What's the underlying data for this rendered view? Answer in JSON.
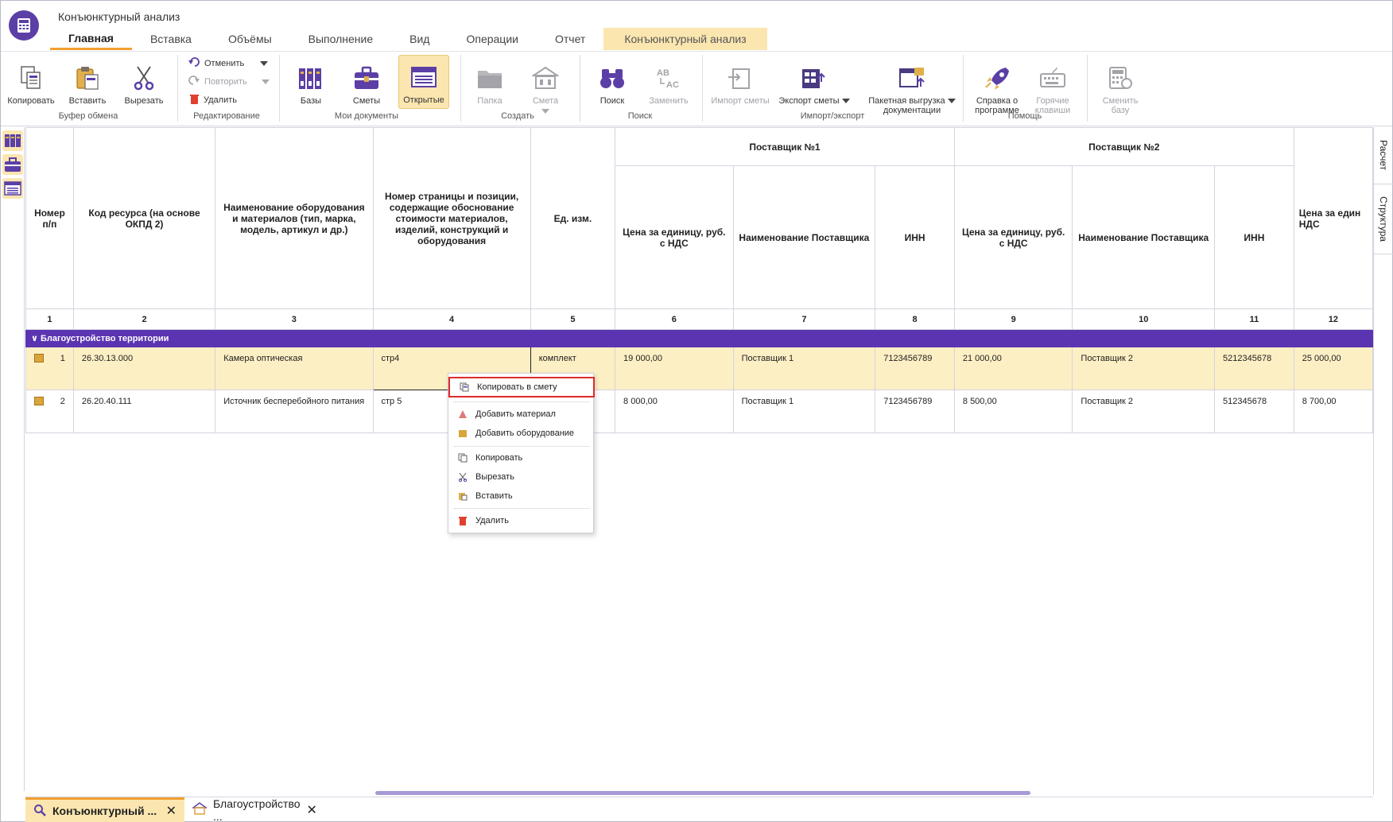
{
  "app": {
    "title": "Конъюнктурный анализ"
  },
  "tabs": [
    {
      "label": "Главная",
      "active": true
    },
    {
      "label": "Вставка"
    },
    {
      "label": "Объёмы"
    },
    {
      "label": "Выполнение"
    },
    {
      "label": "Вид"
    },
    {
      "label": "Операции"
    },
    {
      "label": "Отчет"
    },
    {
      "label": "Конъюнктурный анализ",
      "contextual": true
    }
  ],
  "ribbon": {
    "clipboard": {
      "copy": "Копировать",
      "paste": "Вставить",
      "cut": "Вырезать",
      "group": "Буфер обмена"
    },
    "edit": {
      "undo": "Отменить",
      "redo": "Повторить",
      "delete": "Удалить",
      "group": "Редактирование"
    },
    "docs": {
      "bases": "Базы",
      "estimates": "Сметы",
      "open": "Открытые",
      "group": "Мои документы"
    },
    "create": {
      "folder": "Папка",
      "estimate": "Смета",
      "group": "Создать"
    },
    "search": {
      "find": "Поиск",
      "replace": "Заменить",
      "group": "Поиск"
    },
    "io": {
      "import": "Импорт сметы",
      "export": "Экспорт сметы",
      "batch_line1": "Пакетная выгрузка",
      "batch_line2": "документации",
      "group": "Импорт/экспорт"
    },
    "help": {
      "about_line1": "Справка о",
      "about_line2": "программе",
      "hotkeys_line1": "Горячие",
      "hotkeys_line2": "клавиши",
      "group": "Помощь"
    },
    "switch": {
      "line1": "Сменить",
      "line2": "базу"
    }
  },
  "side_tabs": {
    "calc": "Расчет",
    "structure": "Структура"
  },
  "table": {
    "headers": {
      "num": "Номер п/п",
      "code": "Код ресурса (на основе ОКПД 2)",
      "name": "Наименование оборудования и материалов (тип, марка, модель, артикул и др.)",
      "page": "Номер страницы и позиции, содержащие обоснование стоимости материалов, изделий, конструкций и оборудования",
      "unit": "Ед. изм.",
      "supplier1": "Поставщик №1",
      "supplier2": "Поставщик №2",
      "price": "Цена за единицу, руб. с НДС",
      "supplier_name": "Наименование Поставщика",
      "inn": "ИНН",
      "price_cut": "Цена за един НДС"
    },
    "col_numbers": [
      "1",
      "2",
      "3",
      "4",
      "5",
      "6",
      "7",
      "8",
      "9",
      "10",
      "11",
      "12"
    ],
    "group": "Благоустройство территории",
    "rows": [
      {
        "n": "1",
        "code": "26.30.13.000",
        "name": "Камера оптическая",
        "page": "стр4",
        "unit": "комплект",
        "p1": "19 000,00",
        "s1": "Поставщик 1",
        "inn1": "7123456789",
        "p2": "21 000,00",
        "s2": "Поставщик 2",
        "inn2": "5212345678",
        "p3": "25 000,00"
      },
      {
        "n": "2",
        "code": "26.20.40.111",
        "name": "Источник бесперебойного питания",
        "page": "стр 5",
        "unit": "",
        "p1": "8 000,00",
        "s1": "Поставщик 1",
        "inn1": "7123456789",
        "p2": "8 500,00",
        "s2": "Поставщик 2",
        "inn2": "512345678",
        "p3": "8 700,00"
      }
    ]
  },
  "context_menu": {
    "copy_to_estimate": "Копировать в смету",
    "add_material": "Добавить материал",
    "add_equipment": "Добавить оборудование",
    "copy": "Копировать",
    "cut": "Вырезать",
    "paste": "Вставить",
    "delete": "Удалить"
  },
  "doc_tabs": [
    {
      "label": "Конъюнктурный ..."
    },
    {
      "label": "Благоустройство ..."
    }
  ],
  "colors": {
    "accent": "#5b34b2",
    "highlight": "#fdefc4",
    "tab_accent": "#f0a030",
    "menu_outline": "#e02a2a"
  }
}
